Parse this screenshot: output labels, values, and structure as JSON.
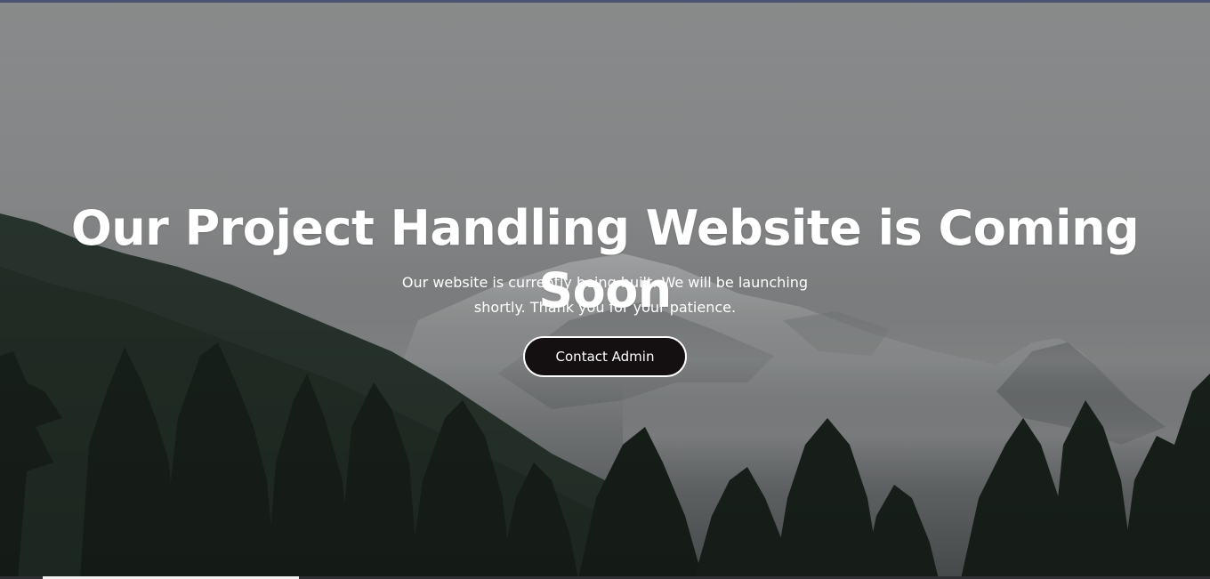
{
  "hero": {
    "headline": "Our Project Handling Website is Coming Soon",
    "subtext": "Our website is currently being built. We will be launching shortly. Thank you for your patience.",
    "cta_label": "Contact Admin",
    "background_image": "misty-mountain-forest",
    "colors": {
      "text": "#ffffff",
      "button_bg": "#140f10",
      "button_border": "#ffffff",
      "sky": "#8e9091",
      "forest": "#1f2a22"
    }
  }
}
